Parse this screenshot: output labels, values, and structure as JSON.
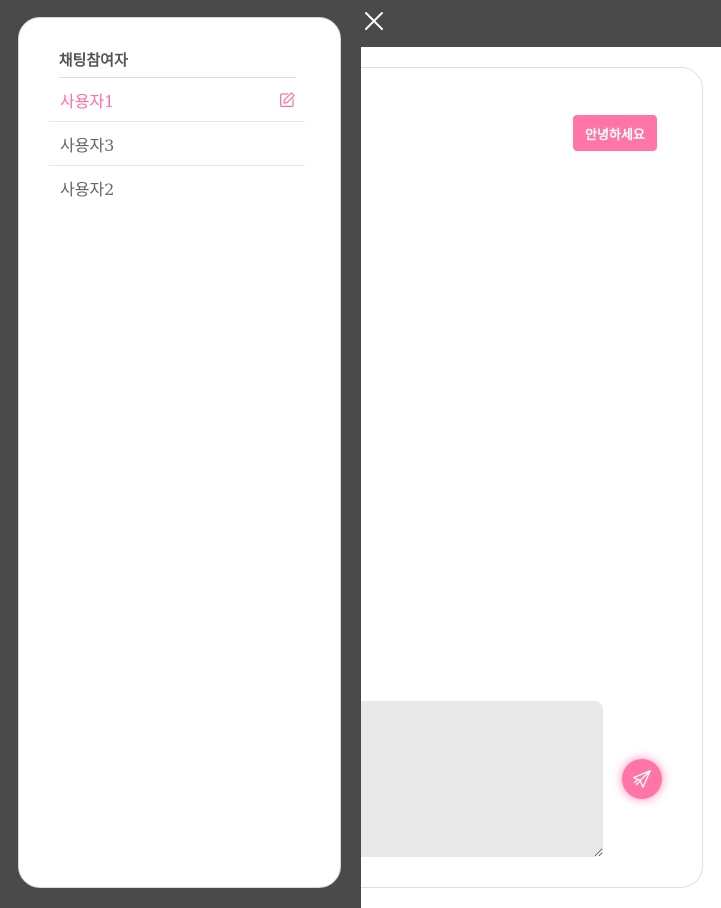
{
  "chat": {
    "messages": [
      {
        "text": "안녕하세요"
      }
    ],
    "input_value": "",
    "send_icon": "paper-plane-icon"
  },
  "drawer": {
    "title": "채팅참여자",
    "participants": [
      {
        "name": "사용자1",
        "active": true,
        "icon": "edit-icon"
      },
      {
        "name": "사용자3",
        "active": false
      },
      {
        "name": "사용자2",
        "active": false
      }
    ]
  },
  "close_icon": "close-icon",
  "colors": {
    "accent": "#ff75a7",
    "overlay": "#4a4a4a",
    "input_bg": "#e9e9e9"
  }
}
